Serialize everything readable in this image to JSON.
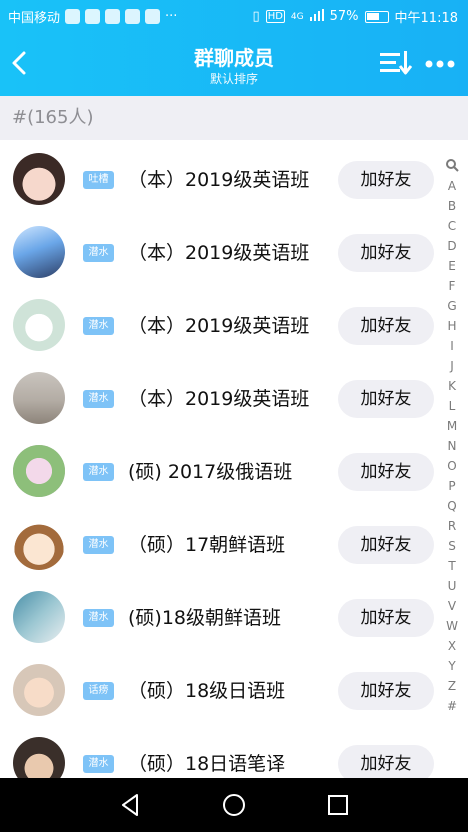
{
  "status": {
    "carrier": "中国移动",
    "signal_type": "4G",
    "hd": "HD",
    "battery": "57%",
    "time": "中午11:18"
  },
  "header": {
    "title": "群聊成员",
    "subtitle": "默认排序"
  },
  "count_label": "#(165人)",
  "members": [
    {
      "badge": "吐槽",
      "name": "（本）2019级英语班",
      "button": "加好友"
    },
    {
      "badge": "潜水",
      "name": "（本）2019级英语班",
      "button": "加好友"
    },
    {
      "badge": "潜水",
      "name": "（本）2019级英语班",
      "button": "加好友"
    },
    {
      "badge": "潜水",
      "name": "（本）2019级英语班",
      "button": "加好友"
    },
    {
      "badge": "潜水",
      "name": "(硕) 2017级俄语班",
      "button": "加好友"
    },
    {
      "badge": "潜水",
      "name": "（硕）17朝鲜语班",
      "button": "加好友"
    },
    {
      "badge": "潜水",
      "name": "(硕)18级朝鲜语班",
      "button": "加好友"
    },
    {
      "badge": "话痨",
      "name": "（硕）18级日语班",
      "button": "加好友"
    },
    {
      "badge": "潜水",
      "name": "（硕）18日语笔译",
      "button": "加好友"
    }
  ],
  "index_letters": [
    "A",
    "B",
    "C",
    "D",
    "E",
    "F",
    "G",
    "H",
    "I",
    "J",
    "K",
    "L",
    "M",
    "N",
    "O",
    "P",
    "Q",
    "R",
    "S",
    "T",
    "U",
    "V",
    "W",
    "X",
    "Y",
    "Z",
    "#"
  ],
  "colors": {
    "header_blue": "#19c2f8",
    "badge_blue": "#7ec3f7",
    "button_bg": "#efeff4"
  }
}
